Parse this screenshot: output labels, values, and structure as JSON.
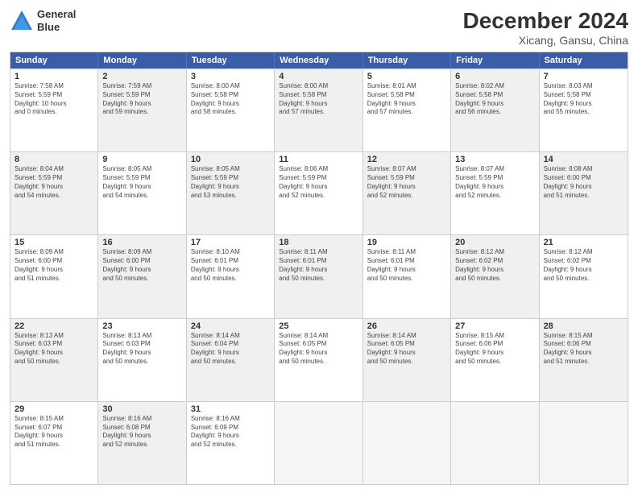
{
  "header": {
    "logo_line1": "General",
    "logo_line2": "Blue",
    "title": "December 2024",
    "subtitle": "Xicang, Gansu, China"
  },
  "weekdays": [
    "Sunday",
    "Monday",
    "Tuesday",
    "Wednesday",
    "Thursday",
    "Friday",
    "Saturday"
  ],
  "rows": [
    [
      {
        "day": "1",
        "lines": [
          "Sunrise: 7:58 AM",
          "Sunset: 5:59 PM",
          "Daylight: 10 hours",
          "and 0 minutes."
        ],
        "shaded": false
      },
      {
        "day": "2",
        "lines": [
          "Sunrise: 7:59 AM",
          "Sunset: 5:59 PM",
          "Daylight: 9 hours",
          "and 59 minutes."
        ],
        "shaded": true
      },
      {
        "day": "3",
        "lines": [
          "Sunrise: 8:00 AM",
          "Sunset: 5:58 PM",
          "Daylight: 9 hours",
          "and 58 minutes."
        ],
        "shaded": false
      },
      {
        "day": "4",
        "lines": [
          "Sunrise: 8:00 AM",
          "Sunset: 5:58 PM",
          "Daylight: 9 hours",
          "and 57 minutes."
        ],
        "shaded": true
      },
      {
        "day": "5",
        "lines": [
          "Sunrise: 8:01 AM",
          "Sunset: 5:58 PM",
          "Daylight: 9 hours",
          "and 57 minutes."
        ],
        "shaded": false
      },
      {
        "day": "6",
        "lines": [
          "Sunrise: 8:02 AM",
          "Sunset: 5:58 PM",
          "Daylight: 9 hours",
          "and 56 minutes."
        ],
        "shaded": true
      },
      {
        "day": "7",
        "lines": [
          "Sunrise: 8:03 AM",
          "Sunset: 5:58 PM",
          "Daylight: 9 hours",
          "and 55 minutes."
        ],
        "shaded": false
      }
    ],
    [
      {
        "day": "8",
        "lines": [
          "Sunrise: 8:04 AM",
          "Sunset: 5:59 PM",
          "Daylight: 9 hours",
          "and 54 minutes."
        ],
        "shaded": true
      },
      {
        "day": "9",
        "lines": [
          "Sunrise: 8:05 AM",
          "Sunset: 5:59 PM",
          "Daylight: 9 hours",
          "and 54 minutes."
        ],
        "shaded": false
      },
      {
        "day": "10",
        "lines": [
          "Sunrise: 8:05 AM",
          "Sunset: 5:59 PM",
          "Daylight: 9 hours",
          "and 53 minutes."
        ],
        "shaded": true
      },
      {
        "day": "11",
        "lines": [
          "Sunrise: 8:06 AM",
          "Sunset: 5:59 PM",
          "Daylight: 9 hours",
          "and 52 minutes."
        ],
        "shaded": false
      },
      {
        "day": "12",
        "lines": [
          "Sunrise: 8:07 AM",
          "Sunset: 5:59 PM",
          "Daylight: 9 hours",
          "and 52 minutes."
        ],
        "shaded": true
      },
      {
        "day": "13",
        "lines": [
          "Sunrise: 8:07 AM",
          "Sunset: 5:59 PM",
          "Daylight: 9 hours",
          "and 52 minutes."
        ],
        "shaded": false
      },
      {
        "day": "14",
        "lines": [
          "Sunrise: 8:08 AM",
          "Sunset: 6:00 PM",
          "Daylight: 9 hours",
          "and 51 minutes."
        ],
        "shaded": true
      }
    ],
    [
      {
        "day": "15",
        "lines": [
          "Sunrise: 8:09 AM",
          "Sunset: 6:00 PM",
          "Daylight: 9 hours",
          "and 51 minutes."
        ],
        "shaded": false
      },
      {
        "day": "16",
        "lines": [
          "Sunrise: 8:09 AM",
          "Sunset: 6:00 PM",
          "Daylight: 9 hours",
          "and 50 minutes."
        ],
        "shaded": true
      },
      {
        "day": "17",
        "lines": [
          "Sunrise: 8:10 AM",
          "Sunset: 6:01 PM",
          "Daylight: 9 hours",
          "and 50 minutes."
        ],
        "shaded": false
      },
      {
        "day": "18",
        "lines": [
          "Sunrise: 8:11 AM",
          "Sunset: 6:01 PM",
          "Daylight: 9 hours",
          "and 50 minutes."
        ],
        "shaded": true
      },
      {
        "day": "19",
        "lines": [
          "Sunrise: 8:11 AM",
          "Sunset: 6:01 PM",
          "Daylight: 9 hours",
          "and 50 minutes."
        ],
        "shaded": false
      },
      {
        "day": "20",
        "lines": [
          "Sunrise: 8:12 AM",
          "Sunset: 6:02 PM",
          "Daylight: 9 hours",
          "and 50 minutes."
        ],
        "shaded": true
      },
      {
        "day": "21",
        "lines": [
          "Sunrise: 8:12 AM",
          "Sunset: 6:02 PM",
          "Daylight: 9 hours",
          "and 50 minutes."
        ],
        "shaded": false
      }
    ],
    [
      {
        "day": "22",
        "lines": [
          "Sunrise: 8:13 AM",
          "Sunset: 6:03 PM",
          "Daylight: 9 hours",
          "and 50 minutes."
        ],
        "shaded": true
      },
      {
        "day": "23",
        "lines": [
          "Sunrise: 8:13 AM",
          "Sunset: 6:03 PM",
          "Daylight: 9 hours",
          "and 50 minutes."
        ],
        "shaded": false
      },
      {
        "day": "24",
        "lines": [
          "Sunrise: 8:14 AM",
          "Sunset: 6:04 PM",
          "Daylight: 9 hours",
          "and 50 minutes."
        ],
        "shaded": true
      },
      {
        "day": "25",
        "lines": [
          "Sunrise: 8:14 AM",
          "Sunset: 6:05 PM",
          "Daylight: 9 hours",
          "and 50 minutes."
        ],
        "shaded": false
      },
      {
        "day": "26",
        "lines": [
          "Sunrise: 8:14 AM",
          "Sunset: 6:05 PM",
          "Daylight: 9 hours",
          "and 50 minutes."
        ],
        "shaded": true
      },
      {
        "day": "27",
        "lines": [
          "Sunrise: 8:15 AM",
          "Sunset: 6:06 PM",
          "Daylight: 9 hours",
          "and 50 minutes."
        ],
        "shaded": false
      },
      {
        "day": "28",
        "lines": [
          "Sunrise: 8:15 AM",
          "Sunset: 6:06 PM",
          "Daylight: 9 hours",
          "and 51 minutes."
        ],
        "shaded": true
      }
    ],
    [
      {
        "day": "29",
        "lines": [
          "Sunrise: 8:15 AM",
          "Sunset: 6:07 PM",
          "Daylight: 9 hours",
          "and 51 minutes."
        ],
        "shaded": false
      },
      {
        "day": "30",
        "lines": [
          "Sunrise: 8:16 AM",
          "Sunset: 6:08 PM",
          "Daylight: 9 hours",
          "and 52 minutes."
        ],
        "shaded": true
      },
      {
        "day": "31",
        "lines": [
          "Sunrise: 8:16 AM",
          "Sunset: 6:09 PM",
          "Daylight: 9 hours",
          "and 52 minutes."
        ],
        "shaded": false
      },
      {
        "day": "",
        "lines": [],
        "shaded": true,
        "empty": true
      },
      {
        "day": "",
        "lines": [],
        "shaded": true,
        "empty": true
      },
      {
        "day": "",
        "lines": [],
        "shaded": true,
        "empty": true
      },
      {
        "day": "",
        "lines": [],
        "shaded": true,
        "empty": true
      }
    ]
  ]
}
